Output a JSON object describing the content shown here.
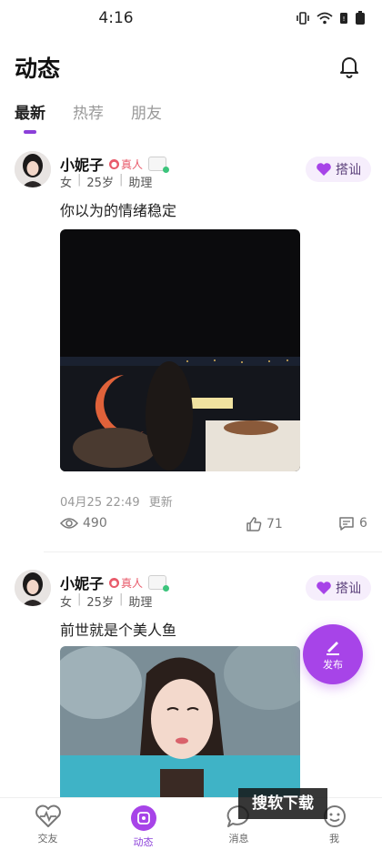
{
  "status_bar": {
    "time": "4:16"
  },
  "header": {
    "title": "动态"
  },
  "tabs": [
    {
      "label": "最新",
      "active": true
    },
    {
      "label": "热荐",
      "active": false
    },
    {
      "label": "朋友",
      "active": false
    }
  ],
  "posts": [
    {
      "username": "小妮子",
      "real_badge": "真人",
      "gender": "女",
      "age": "25岁",
      "job": "助理",
      "flirt_label": "搭讪",
      "text": "你以为的情绪稳定",
      "time": "04月25 22:49",
      "update_label": "更新",
      "views": "490",
      "likes": "71",
      "comments": "6"
    },
    {
      "username": "小妮子",
      "real_badge": "真人",
      "gender": "女",
      "age": "25岁",
      "job": "助理",
      "flirt_label": "搭讪",
      "text": "前世就是个美人鱼"
    }
  ],
  "fab": {
    "label": "发布"
  },
  "watermark": "搜软下载",
  "tabbar": [
    {
      "label": "交友",
      "icon": "heartbeat-icon",
      "active": false
    },
    {
      "label": "动态",
      "icon": "dynamic-icon",
      "active": true
    },
    {
      "label": "消息",
      "icon": "message-icon",
      "active": false
    },
    {
      "label": "我",
      "icon": "profile-icon",
      "active": false
    }
  ],
  "colors": {
    "accent": "#8b3fd9",
    "fab": "#a744e8",
    "real_badge": "#e85a6a"
  }
}
